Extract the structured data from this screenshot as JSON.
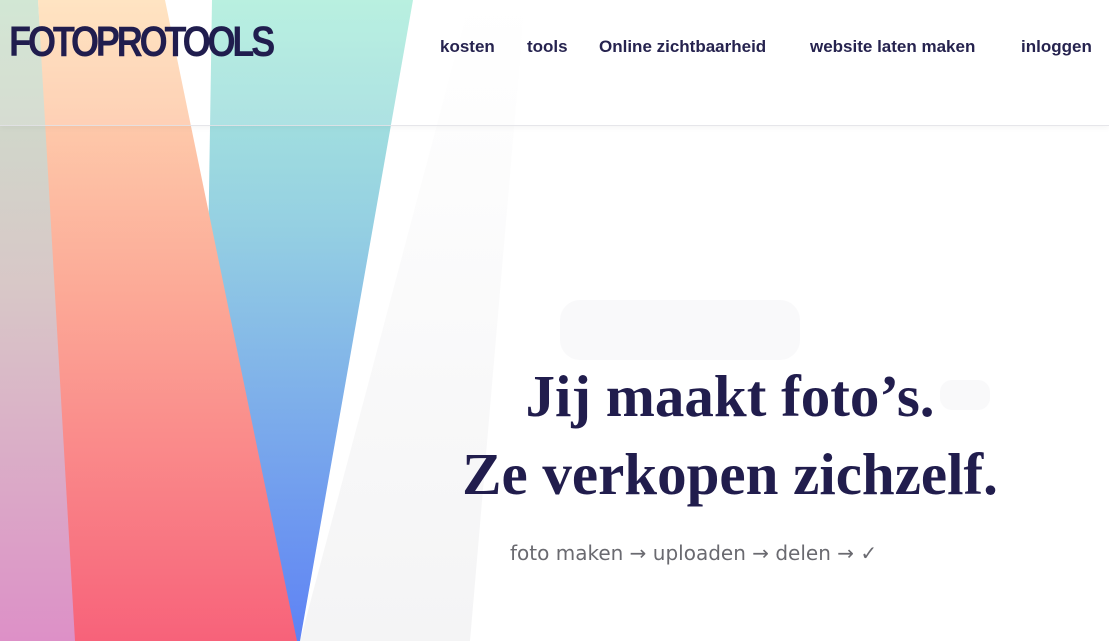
{
  "site": {
    "logo_text": "FOTOPROTOOLS"
  },
  "nav": {
    "items": [
      {
        "label": "kosten"
      },
      {
        "label": "tools"
      },
      {
        "label": "Online zichtbaarheid"
      },
      {
        "label": "website laten maken"
      },
      {
        "label": "inloggen"
      }
    ]
  },
  "hero": {
    "line1": "Jij maakt foto’s.",
    "line2": "Ze verkopen zichzelf.",
    "subline": "foto maken → uploaden → delen → ✓"
  },
  "colors": {
    "brand_navy": "#201d4e",
    "hero_text": "#211d4d",
    "subtext": "#6a6a70",
    "art_peach": "#ffd9b0",
    "art_coral": "#f86d7d",
    "art_mint": "#a8ecd8",
    "art_blue": "#5d86f3",
    "art_pink": "#dd92c6"
  }
}
